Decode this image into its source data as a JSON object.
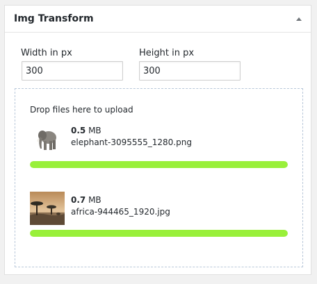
{
  "panel": {
    "title": "Img Transform",
    "toggle_icon": "triangle-up-icon"
  },
  "fields": {
    "width": {
      "label": "Width in px",
      "value": "300"
    },
    "height": {
      "label": "Height in px",
      "value": "300"
    }
  },
  "dropzone": {
    "text": "Drop files here to upload"
  },
  "files": [
    {
      "size_value": "0.5",
      "size_unit": " MB",
      "name": "elephant-3095555_1280.png",
      "progress": 1.0
    },
    {
      "size_value": "0.7",
      "size_unit": " MB",
      "name": "africa-944465_1920.jpg",
      "progress": 1.0
    }
  ],
  "colors": {
    "progress_fill": "#99f03a",
    "dropzone_border": "#b8c7d9"
  }
}
